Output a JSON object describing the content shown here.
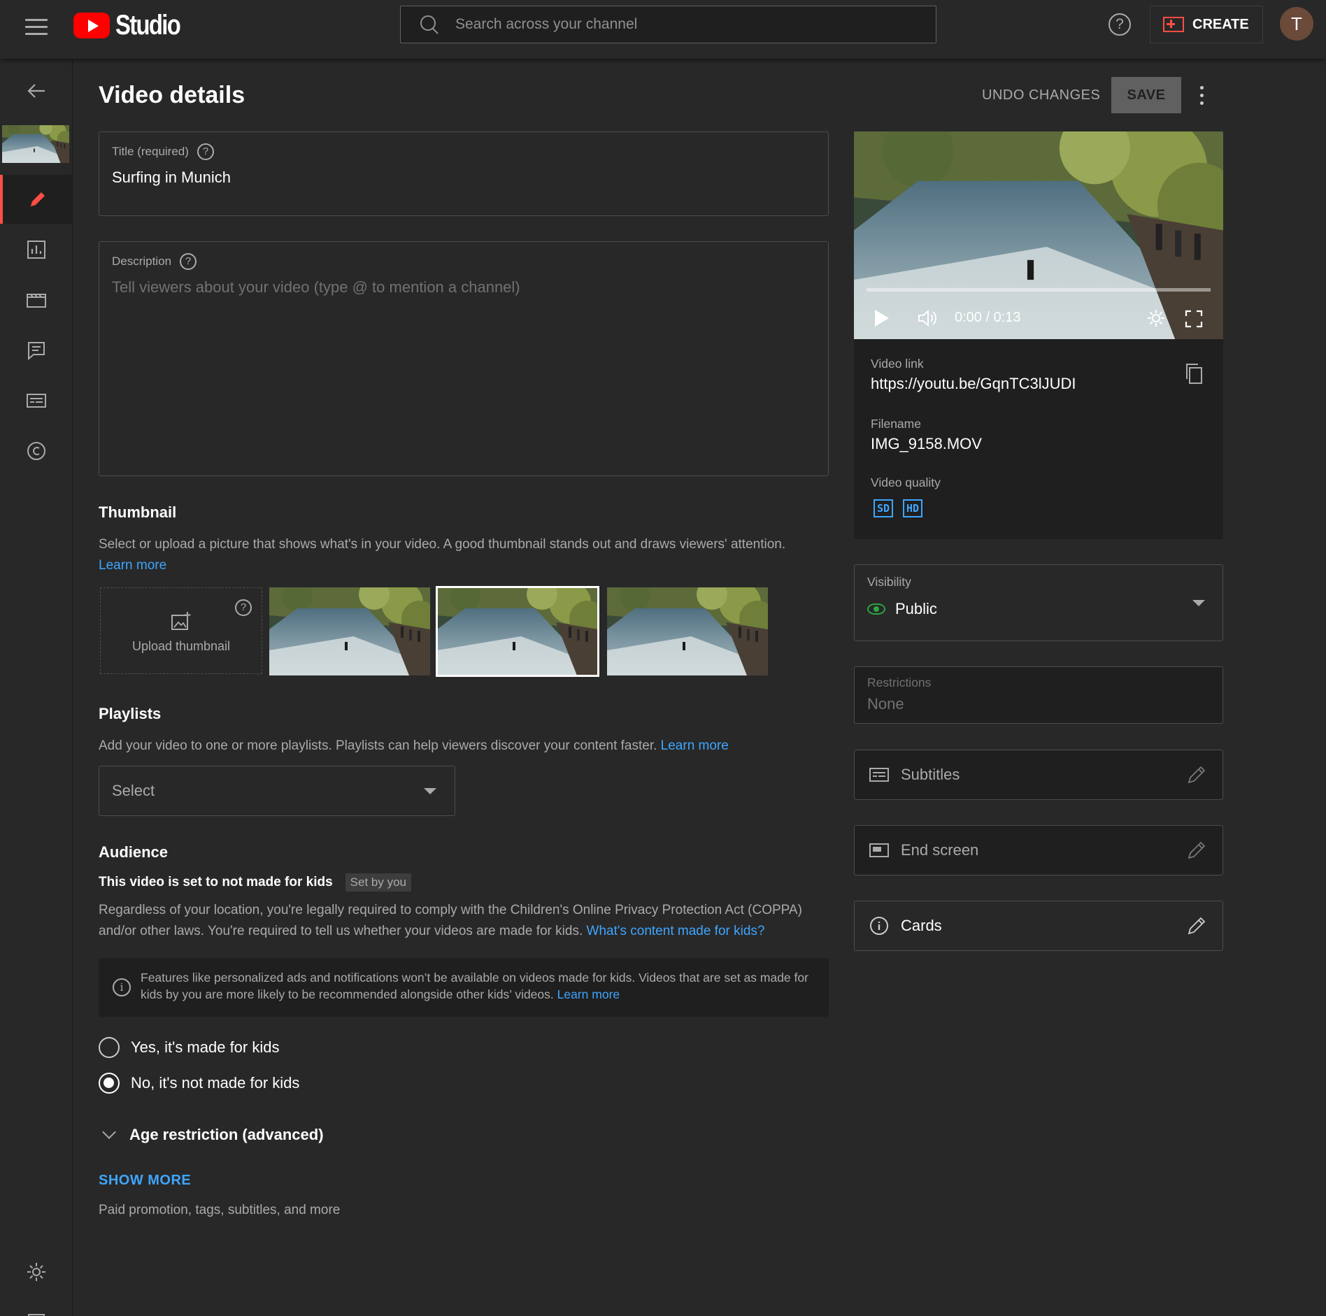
{
  "header": {
    "app_name": "Studio",
    "search_placeholder": "Search across your channel",
    "help_glyph": "?",
    "create_label": "CREATE",
    "avatar_initial": "T"
  },
  "nav": {
    "items": [
      {
        "icon": "pencil-icon",
        "active": true
      },
      {
        "icon": "analytics-icon"
      },
      {
        "icon": "editor-icon"
      },
      {
        "icon": "comments-icon"
      },
      {
        "icon": "subtitles-icon"
      },
      {
        "icon": "copyright-icon"
      }
    ],
    "bottom": [
      {
        "icon": "settings-icon"
      },
      {
        "icon": "feedback-icon"
      }
    ]
  },
  "page": {
    "title": "Video details",
    "undo_label": "UNDO CHANGES",
    "save_label": "SAVE"
  },
  "details": {
    "title_label": "Title (required)",
    "title_value": "Surfing in Munich",
    "description_label": "Description",
    "description_placeholder": "Tell viewers about your video (type @ to mention a channel)"
  },
  "thumbnail": {
    "heading": "Thumbnail",
    "text": "Select or upload a picture that shows what's in your video. A good thumbnail stands out and draws viewers' attention.",
    "learn_more": "Learn more",
    "upload_label": "Upload thumbnail",
    "selected_index": 1
  },
  "playlists": {
    "heading": "Playlists",
    "text": "Add your video to one or more playlists. Playlists can help viewers discover your content faster.",
    "learn_more": "Learn more",
    "select_value": "Select"
  },
  "audience": {
    "heading": "Audience",
    "status": "This video is set to not made for kids",
    "chip": "Set by you",
    "text": "Regardless of your location, you're legally required to comply with the Children's Online Privacy Protection Act (COPPA) and/or other laws. You're required to tell us whether your videos are made for kids.",
    "link": "What's content made for kids?",
    "info": "Features like personalized ads and notifications won’t be available on videos made for kids. Videos that are set as made for kids by you are more likely to be recommended alongside other kids’ videos.",
    "info_link": "Learn more",
    "option_yes": "Yes, it's made for kids",
    "option_no": "No, it's not made for kids",
    "selected": "no",
    "age_restriction": "Age restriction (advanced)",
    "show_more": "SHOW MORE",
    "show_more_sub": "Paid promotion, tags, subtitles, and more"
  },
  "preview": {
    "timecode": "0:00 / 0:13",
    "progress": 0,
    "video_link_label": "Video link",
    "video_link": "https://youtu.be/GqnTC3lJUDI",
    "filename_label": "Filename",
    "filename": "IMG_9158.MOV",
    "quality_label": "Video quality",
    "quality_badges": [
      "SD",
      "HD"
    ]
  },
  "visibility": {
    "label": "Visibility",
    "value": "Public"
  },
  "restrictions": {
    "label": "Restrictions",
    "value": "None"
  },
  "tools": {
    "subtitles": "Subtitles",
    "end_screen": "End screen",
    "cards": "Cards"
  },
  "colors": {
    "background": "#282828",
    "accent_red": "#ff0000",
    "link_blue": "#3ea6ff",
    "public_green": "#2ba640"
  }
}
